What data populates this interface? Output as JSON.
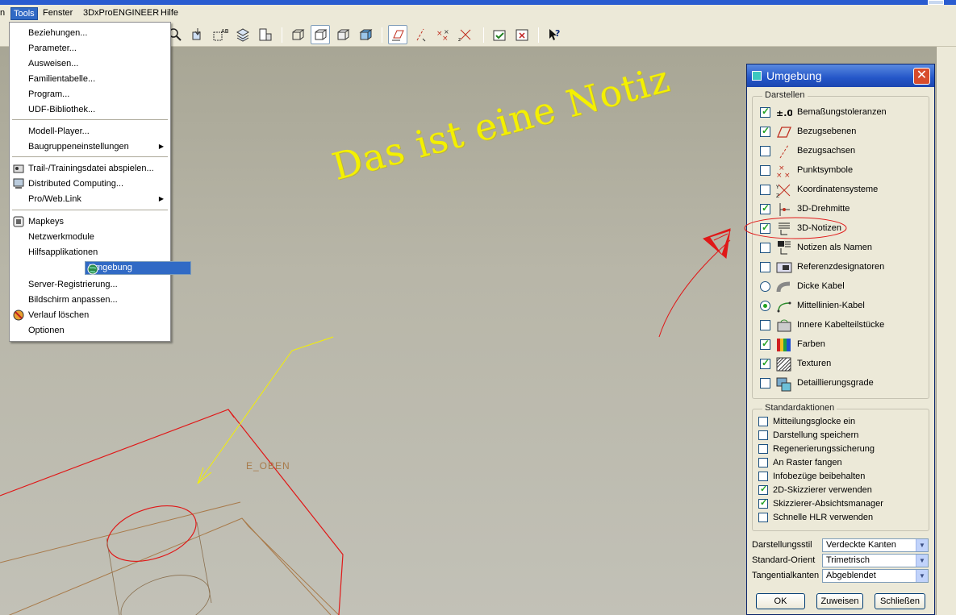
{
  "menubar": {
    "items": [
      "n",
      "Tools",
      "Fenster",
      "3DxProENGINEER",
      "Hilfe"
    ]
  },
  "tools_menu": {
    "items": [
      {
        "label": "Beziehungen...",
        "icon": "none"
      },
      {
        "label": "Parameter...",
        "icon": "none"
      },
      {
        "label": "Ausweisen...",
        "icon": "none"
      },
      {
        "label": "Familientabelle...",
        "icon": "none"
      },
      {
        "label": "Program...",
        "icon": "none"
      },
      {
        "label": "UDF-Bibliothek...",
        "icon": "none"
      },
      {
        "label": "Modell-Player...",
        "icon": "none"
      },
      {
        "label": "Baugruppeneinstellungen",
        "icon": "none",
        "submenu": true
      },
      {
        "label": "Trail-/Trainingsdatei abspielen...",
        "icon": "trail-icon"
      },
      {
        "label": "Distributed Computing...",
        "icon": "computer-icon"
      },
      {
        "label": "Pro/Web.Link",
        "icon": "none",
        "submenu": true
      },
      {
        "label": "Mapkeys",
        "icon": "mapkeys-icon"
      },
      {
        "label": "Netzwerkmodule",
        "icon": "none"
      },
      {
        "label": "Hilfsapplikationen",
        "icon": "none"
      },
      {
        "label": "Umgebung",
        "icon": "globe-icon",
        "selected": true
      },
      {
        "label": "Server-Registrierung...",
        "icon": "none"
      },
      {
        "label": "Bildschirm anpassen...",
        "icon": "none"
      },
      {
        "label": "Verlauf löschen",
        "icon": "clear-history-icon"
      },
      {
        "label": "Optionen",
        "icon": "none"
      }
    ]
  },
  "viewport": {
    "note_text": "Das ist eine Notiz",
    "datum_label": "E_OBEN"
  },
  "dialog": {
    "title": "Umgebung",
    "close_glyph": "✕",
    "display_group": "Darstellen",
    "display_items": [
      {
        "label": "Bemaßungstoleranzen",
        "checked": true,
        "type": "check",
        "icon": "tolerance-icon",
        "icon_text": "±.01"
      },
      {
        "label": "Bezugsebenen",
        "checked": true,
        "type": "check",
        "icon": "datum-plane-icon"
      },
      {
        "label": "Bezugsachsen",
        "checked": false,
        "type": "check",
        "icon": "datum-axis-icon"
      },
      {
        "label": "Punktsymbole",
        "checked": false,
        "type": "check",
        "icon": "point-symbol-icon"
      },
      {
        "label": "Koordinatensysteme",
        "checked": false,
        "type": "check",
        "icon": "coordinate-system-icon"
      },
      {
        "label": "3D-Drehmitte",
        "checked": true,
        "type": "check",
        "icon": "spin-center-icon"
      },
      {
        "label": "3D-Notizen",
        "checked": true,
        "type": "check",
        "icon": "3d-note-icon"
      },
      {
        "label": "Notizen als Namen",
        "checked": false,
        "type": "check",
        "icon": "note-name-icon"
      },
      {
        "label": "Referenzdesignatoren",
        "checked": false,
        "type": "check",
        "icon": "ref-designator-icon"
      },
      {
        "label": "Dicke Kabel",
        "checked": false,
        "type": "radio",
        "icon": "thick-cable-icon"
      },
      {
        "label": "Mittellinien-Kabel",
        "checked": true,
        "type": "radio",
        "icon": "centerline-cable-icon"
      },
      {
        "label": "Innere Kabelteilstücke",
        "checked": false,
        "type": "check",
        "icon": "inner-cable-icon"
      },
      {
        "label": "Farben",
        "checked": true,
        "type": "check",
        "icon": "colors-icon"
      },
      {
        "label": "Texturen",
        "checked": true,
        "type": "check",
        "icon": "textures-icon"
      },
      {
        "label": "Detaillierungsgrade",
        "checked": false,
        "type": "check",
        "icon": "detail-level-icon"
      }
    ],
    "actions_group": "Standardaktionen",
    "action_items": [
      {
        "label": "Mitteilungsglocke ein",
        "checked": false
      },
      {
        "label": "Darstellung speichern",
        "checked": false
      },
      {
        "label": "Regenerierungssicherung",
        "checked": false
      },
      {
        "label": "An Raster fangen",
        "checked": false
      },
      {
        "label": "Infobezüge beibehalten",
        "checked": false
      },
      {
        "label": "2D-Skizzierer verwenden",
        "checked": true
      },
      {
        "label": "Skizzierer-Absichtsmanager",
        "checked": true
      },
      {
        "label": "Schnelle HLR verwenden",
        "checked": false
      }
    ],
    "fields": [
      {
        "label": "Darstellungsstil",
        "value": "Verdeckte Kanten"
      },
      {
        "label": "Standard-Orient",
        "value": "Trimetrisch"
      },
      {
        "label": "Tangentialkanten",
        "value": "Abgeblendet"
      }
    ],
    "buttons": {
      "ok": "OK",
      "assign": "Zuweisen",
      "close": "Schließen"
    }
  },
  "colors": {
    "accent": "#316ac5",
    "note": "#f4f000",
    "model_edge": "#e01818",
    "datum": "#a87a4a"
  }
}
